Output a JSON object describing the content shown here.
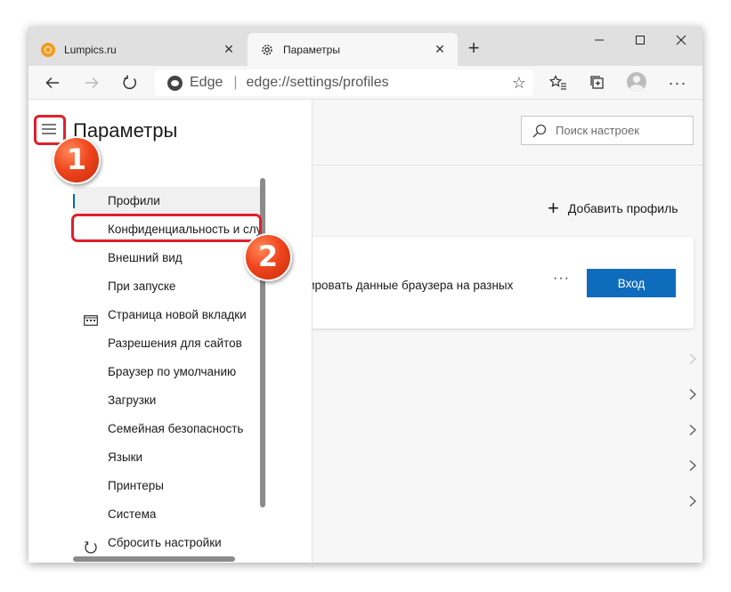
{
  "tabs": [
    {
      "label": "Lumpics.ru",
      "active": false
    },
    {
      "label": "Параметры",
      "active": true
    }
  ],
  "address": {
    "brand": "Edge",
    "separator": "|",
    "url": "edge://settings/profiles"
  },
  "sidebar": {
    "title": "Параметры",
    "items": [
      {
        "label": "Профили",
        "icon": "person-icon",
        "selected": true
      },
      {
        "label": "Конфиденциальность и службы",
        "icon": "lock-icon",
        "selected": false
      },
      {
        "label": "Внешний вид",
        "icon": "paint-icon",
        "selected": false
      },
      {
        "label": "При запуске",
        "icon": "power-icon",
        "selected": false
      },
      {
        "label": "Страница новой вкладки",
        "icon": "new-tab-page-icon",
        "selected": false
      },
      {
        "label": "Разрешения для сайтов",
        "icon": "permissions-icon",
        "selected": false
      },
      {
        "label": "Браузер по умолчанию",
        "icon": "browser-icon",
        "selected": false
      },
      {
        "label": "Загрузки",
        "icon": "download-icon",
        "selected": false
      },
      {
        "label": "Семейная безопасность",
        "icon": "family-icon",
        "selected": false
      },
      {
        "label": "Языки",
        "icon": "language-icon",
        "selected": false
      },
      {
        "label": "Принтеры",
        "icon": "printer-icon",
        "selected": false
      },
      {
        "label": "Система",
        "icon": "system-icon",
        "selected": false
      },
      {
        "label": "Сбросить настройки",
        "icon": "reset-icon",
        "selected": false
      }
    ]
  },
  "main": {
    "search_placeholder": "Поиск настроек",
    "add_profile": "Добавить профиль",
    "sync_text": "ировать данные браузера на разных",
    "more": "···",
    "sign_in": "Вход"
  },
  "annotations": {
    "step1": "1",
    "step2": "2"
  },
  "colors": {
    "accent": "#0f6cbd",
    "highlight": "#e0202b",
    "badge": "#f0461e"
  }
}
